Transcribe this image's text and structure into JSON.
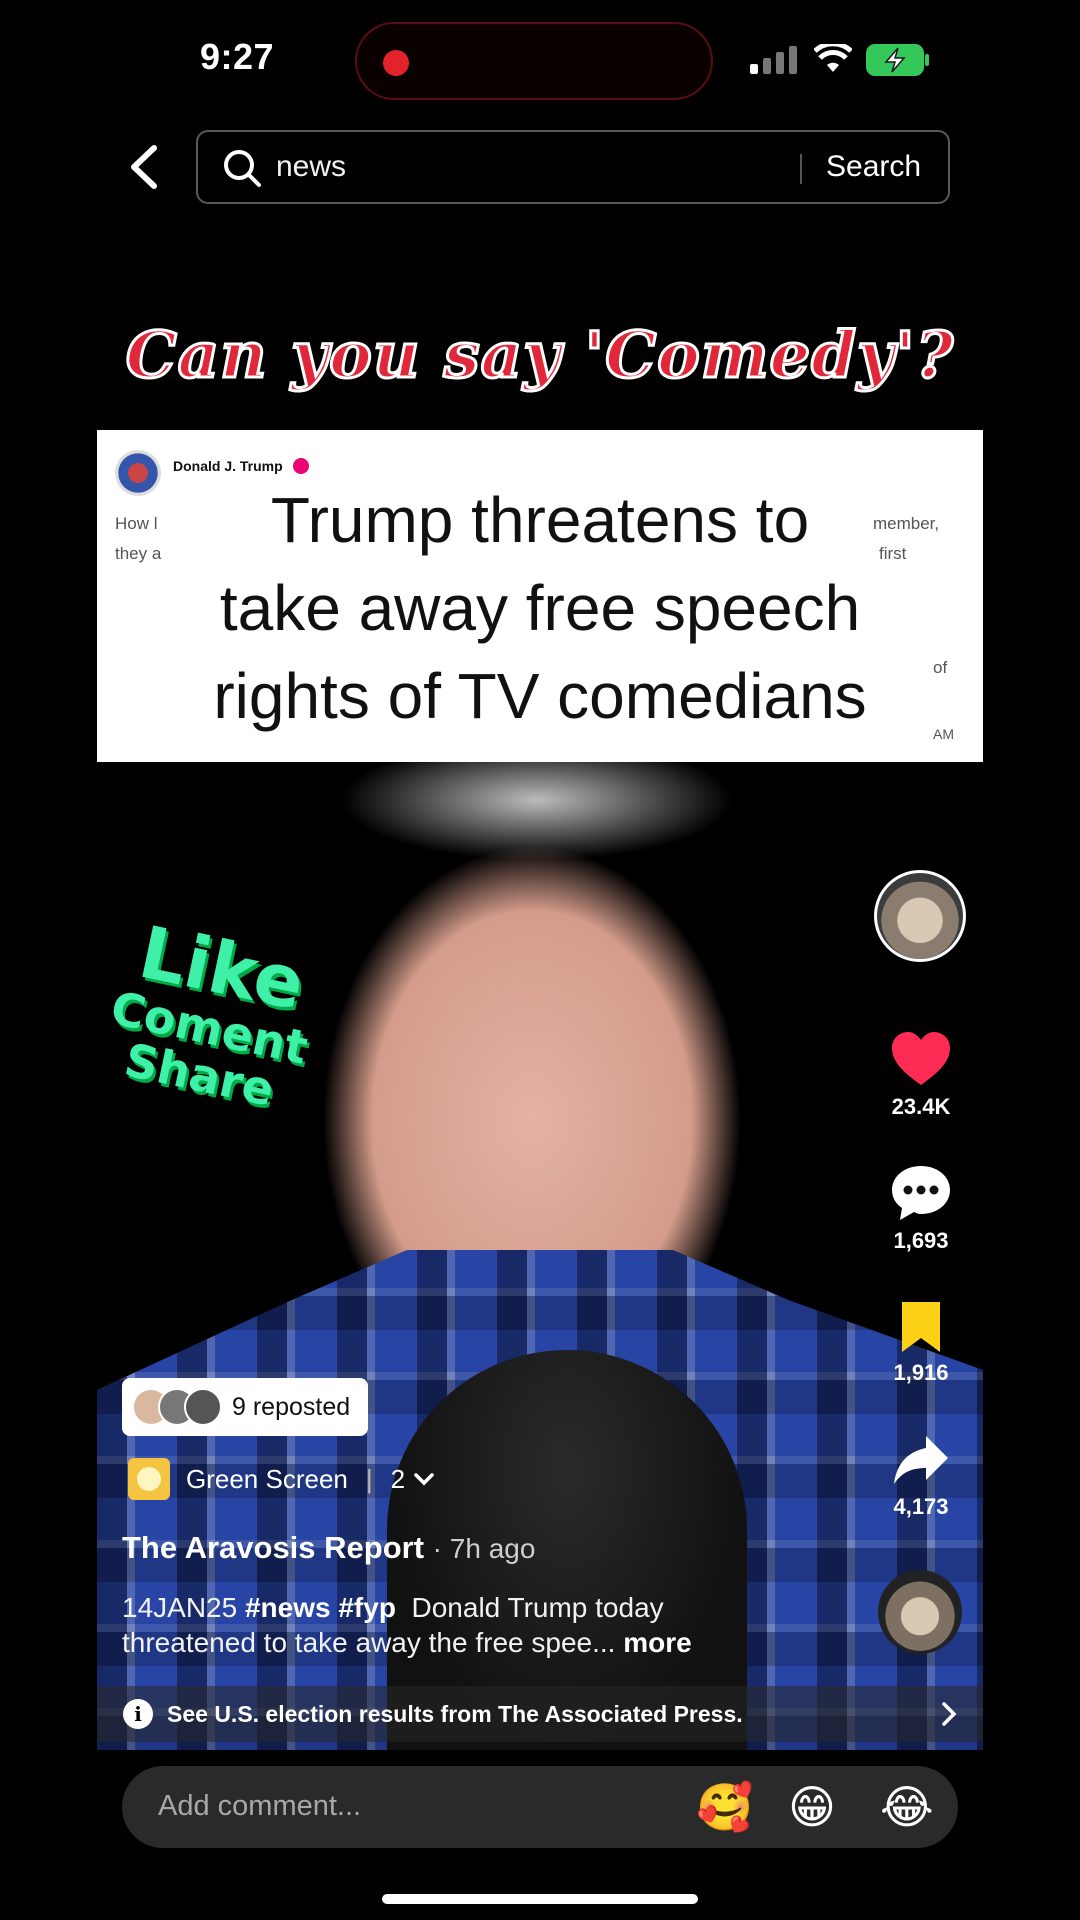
{
  "status_bar": {
    "time": "9:27"
  },
  "search": {
    "query": "news",
    "button_label": "Search"
  },
  "video": {
    "title_overlay": "Can you say 'Comedy'?",
    "tweet": {
      "author": "Donald J. Trump",
      "fragments": [
        "How l",
        "they a",
        "member,",
        "first",
        "of",
        "AM"
      ]
    },
    "headline_lines": [
      "Trump threatens to",
      "take away free speech",
      "rights of TV comedians"
    ],
    "cta": {
      "like": "Like",
      "comment": "Coment",
      "share": "Share"
    }
  },
  "rail": {
    "likes": "23.4K",
    "comments": "1,693",
    "saves": "1,916",
    "shares": "4,173"
  },
  "overlay": {
    "reposted": "9 reposted",
    "effect_name": "Green Screen",
    "effect_count": "2",
    "author": "The Aravosis Report",
    "time_ago": "7h ago",
    "caption_prefix": "14JAN25",
    "hashtags": [
      "#news",
      "#fyp"
    ],
    "caption_text": "Donald Trump today threatened to take away the free spee...",
    "more_label": "more"
  },
  "banner": {
    "text": "See U.S. election results from The Associated Press."
  },
  "comment_bar": {
    "placeholder": "Add comment...",
    "emojis": [
      "🥰",
      "😁",
      "😂"
    ]
  },
  "colors": {
    "like_red": "#fe2c55",
    "bookmark_yellow": "#fcd116",
    "cta_green": "#3ef0a8",
    "title_red": "#e0283a"
  }
}
